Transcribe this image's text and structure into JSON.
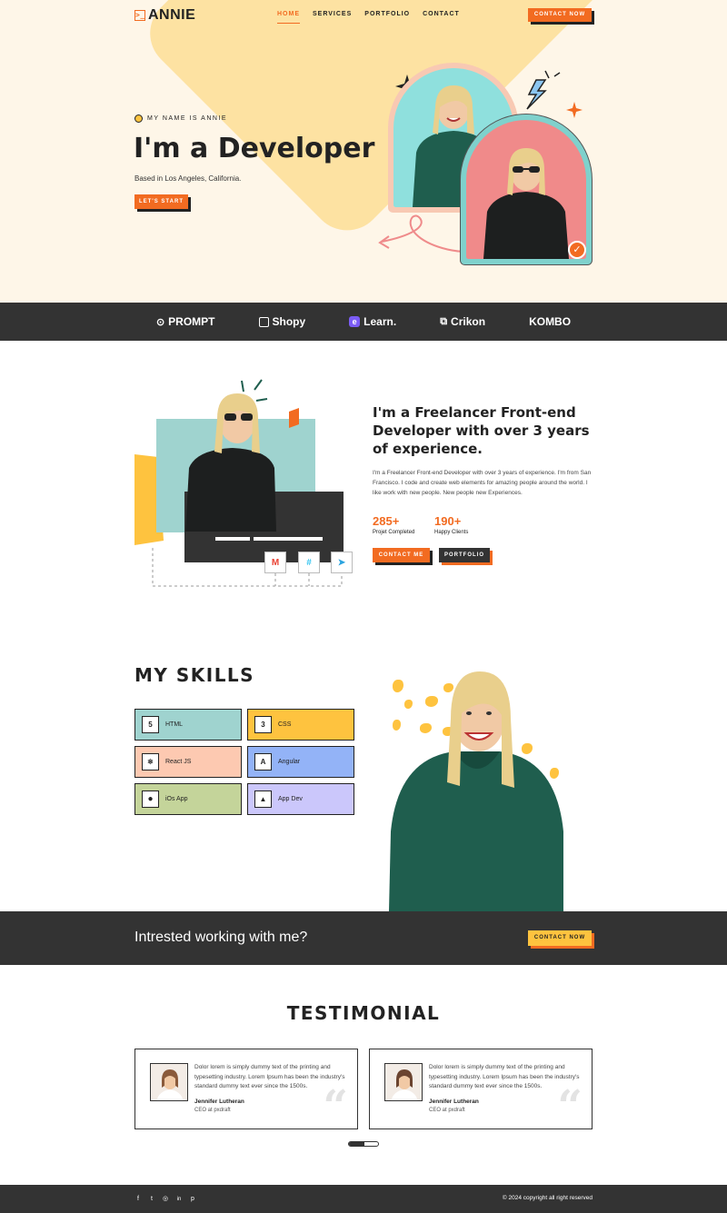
{
  "header": {
    "logo_glyph": ">_",
    "logo_text": "ANNIE",
    "nav": [
      "HOME",
      "SERVICES",
      "PORTFOLIO",
      "CONTACT"
    ],
    "contact_button": "CONTACT NOW"
  },
  "hero": {
    "kicker": "MY NAME IS ANNIE",
    "title": "I'm a Developer",
    "subtitle": "Based in Los Angeles, California.",
    "button": "LET'S START"
  },
  "brands": [
    {
      "icon": "circle-p-icon",
      "glyph": "⊙",
      "name": "PROMPT"
    },
    {
      "icon": "bag-icon",
      "glyph": "🛍",
      "name": "Shopy"
    },
    {
      "icon": "e-logo-icon",
      "glyph": "e",
      "name": "Learn."
    },
    {
      "icon": "copy-icon",
      "glyph": "⧉",
      "name": "Crikon"
    },
    {
      "icon": "k-logo-icon",
      "glyph": "",
      "name": "KOMBO"
    }
  ],
  "about": {
    "title": "I'm a Freelancer Front-end Developer with over 3 years of experience.",
    "text": "I'm a Freelancer Front-end Developer with over 3 years of experience. I'm from San Francisco. I code and create web elements for amazing people around the world. I like work with new people. New people new Experiences.",
    "stats": [
      {
        "value": "285+",
        "label": "Projet Completed"
      },
      {
        "value": "190+",
        "label": "Happy Clients"
      }
    ],
    "contact_button": "CONTACT ME",
    "portfolio_button": "PORTFOLIO",
    "tools": [
      {
        "icon": "gmail-icon",
        "glyph": "M",
        "color": "#ea4335"
      },
      {
        "icon": "slack-icon",
        "glyph": "#",
        "color": "#36c5f0"
      },
      {
        "icon": "telegram-icon",
        "glyph": "➤",
        "color": "#2aa3df"
      }
    ]
  },
  "skills": {
    "title": "MY SKILLS",
    "items": [
      {
        "label": "HTML",
        "icon": "html5-icon",
        "glyph": "5",
        "color": "#9fd3cf"
      },
      {
        "label": "CSS",
        "icon": "css3-icon",
        "glyph": "3",
        "color": "#fec33f"
      },
      {
        "label": "React JS",
        "icon": "react-icon",
        "glyph": "⚛",
        "color": "#fdc9b1"
      },
      {
        "label": "Angular",
        "icon": "angular-icon",
        "glyph": "A",
        "color": "#93b3f7"
      },
      {
        "label": "iOs App",
        "icon": "apple-icon",
        "glyph": "",
        "color": "#c4d49a"
      },
      {
        "label": "App Dev",
        "icon": "android-icon",
        "glyph": "▲",
        "color": "#cbc7fb"
      }
    ]
  },
  "cta": {
    "text": "Intrested working with me?",
    "button": "CONTACT NOW"
  },
  "testimonial": {
    "title": "TESTIMONIAL",
    "cards": [
      {
        "text": "Dolor lorem is simply dummy text of the printing and typesetting industry. Lorem Ipsum has been the industry's standard dummy text ever since the 1500s.",
        "name": "Jennifer Lutheran",
        "role": "CEO at pxdraft"
      },
      {
        "text": "Dolor lorem is simply dummy text of the printing and typesetting industry. Lorem Ipsum has been the industry's standard dummy text ever since the 1500s.",
        "name": "Jennifer Lutheran",
        "role": "CEO at pxdraft"
      }
    ],
    "quote_glyph": "“"
  },
  "footer": {
    "social": [
      {
        "icon": "facebook-icon",
        "glyph": "f"
      },
      {
        "icon": "twitter-icon",
        "glyph": "t"
      },
      {
        "icon": "instagram-icon",
        "glyph": "◎"
      },
      {
        "icon": "linkedin-icon",
        "glyph": "in"
      },
      {
        "icon": "pinterest-icon",
        "glyph": "p"
      }
    ],
    "copyright": "© 2024 copyright all right reserved"
  },
  "colors": {
    "accent": "#f26b21",
    "yellow": "#fec33f",
    "dark": "#333333",
    "hero_bg": "#fef6e8"
  }
}
